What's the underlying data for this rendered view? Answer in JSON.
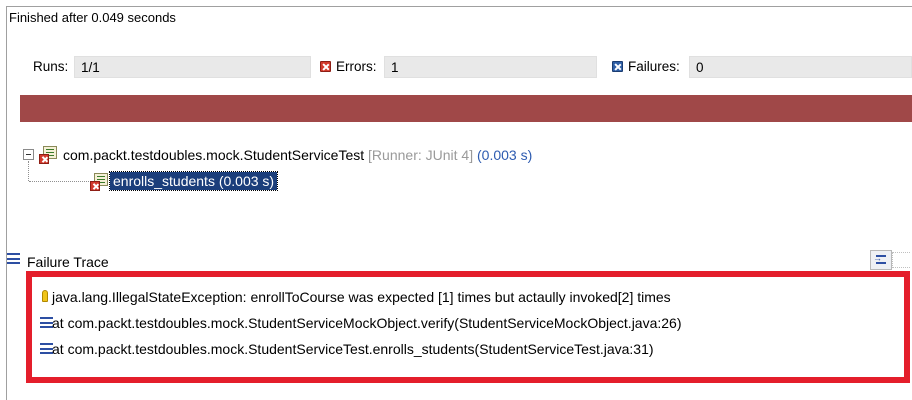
{
  "title": "Finished after 0.049 seconds",
  "counters": {
    "runs_label": "Runs:",
    "runs_value": "1/1",
    "errors_label": "Errors:",
    "errors_value": "1",
    "failures_label": "Failures:",
    "failures_value": "0"
  },
  "progress": {
    "fraction_complete": 1.0,
    "color": "#a04848"
  },
  "tree": {
    "suite": {
      "name": "com.packt.testdoubles.mock.StudentServiceTest",
      "runner": "[Runner: JUnit 4]",
      "time": "(0.003 s)"
    },
    "case": {
      "label": "enrolls_students (0.003 s)"
    }
  },
  "failure_trace": {
    "title": "Failure Trace",
    "lines": [
      "java.lang.IllegalStateException: enrollToCourse was expected [1] times but actaully invoked[2] times",
      "at com.packt.testdoubles.mock.StudentServiceMockObject.verify(StudentServiceMockObject.java:26)",
      "at com.packt.testdoubles.mock.StudentServiceTest.enrolls_students(StudentServiceTest.java:31)"
    ]
  },
  "colors": {
    "error": "#d33a2c",
    "failure": "#2f5fa6",
    "selection": "#1b3e7b",
    "highlight_box": "#e41e2b"
  }
}
